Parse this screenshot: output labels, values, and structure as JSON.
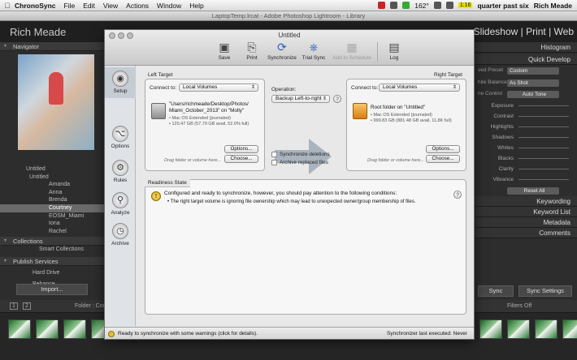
{
  "menubar": {
    "app_name": "ChronoSync",
    "items": [
      "File",
      "Edit",
      "View",
      "Actions",
      "Window",
      "Help"
    ],
    "temp": "162°",
    "battery": "1:16",
    "clock": "quarter past six",
    "user": "Rich Meade"
  },
  "lightroom": {
    "window_title": "LaptopTemp.lrcat - Adobe Photoshop Lightroom - Library",
    "user_name": "Rich Meade",
    "modules": "Slideshow | Print | Web",
    "navigator_label": "Navigator",
    "folders": [
      "Untitled",
      "Untitled",
      "Amanda",
      "Anna",
      "Brenda",
      "Courtney",
      "EOSM_Miami",
      "Iona",
      "Rachel"
    ],
    "collections_label": "Collections",
    "smart_collections_label": "Smart Collections",
    "publish_services_label": "Publish Services",
    "hard_drive_label": "Hard Drive",
    "behance_label": "Behance",
    "import_button": "Import...",
    "right_panels": {
      "histogram": "Histogram",
      "quick_develop": "Quick Develop",
      "saved_preset_label": "ved Preset",
      "saved_preset_value": "Custom",
      "white_balance_label": "hite Balance",
      "white_balance_value": "As Shot",
      "tone_control_label": "ne Control",
      "auto_tone": "Auto Tone",
      "exposure": "Exposure",
      "contrast": "Contrast",
      "highlights": "Highlights",
      "shadows": "Shadows",
      "whites": "Whites",
      "blacks": "Blacks",
      "clarity": "Clarity",
      "vibrance": "Vibrance",
      "reset_all": "Reset All",
      "keywording": "Keywording",
      "keyword_list": "Keyword List",
      "metadata": "Metadata",
      "comments": "Comments",
      "sync_button": "Sync",
      "sync_settings_button": "Sync Settings"
    },
    "filmstrip": {
      "page_1": "1",
      "page_2": "2",
      "folder_label": "Folder : Cou",
      "filter_label": "Filters Off"
    }
  },
  "chronosync": {
    "title": "Untitled",
    "toolbar": [
      "Save",
      "Print",
      "Synchronize",
      "Trial Sync",
      "Add to Schedule",
      "Log"
    ],
    "sidebar": [
      "Setup",
      "Options",
      "Rules",
      "Analyze",
      "Archive"
    ],
    "left_target": {
      "label": "Left Target",
      "connect_to_label": "Connect to:",
      "connect_to_value": "Local Volumes",
      "path_line1": "\"Users/richmeade/Desktop/Photos/",
      "path_line2": "Miami_October_2013\" on \"Molly\"",
      "format": "• Mac OS Extended (journaled)",
      "capacity": "• 120.47 GB (57.79 GB avail, 52.0% full)",
      "options_button": "Options...",
      "choose_button": "Choose...",
      "hint": "Drag folder or volume here..."
    },
    "right_target": {
      "label": "Right Target",
      "connect_to_label": "Connect to:",
      "connect_to_value": "Local Volumes",
      "path_line1": "Root folder on \"Untitled\"",
      "format": "• Mac OS Extended (journaled)",
      "capacity": "• 999.83 GB (881.48 GB avail, 11.8K full)",
      "options_button": "Options...",
      "choose_button": "Choose...",
      "hint": "Drag folder or volume here..."
    },
    "operation": {
      "label": "Operation:",
      "value": "Backup Left-to-right",
      "synchronize_deletions": "Synchronize deletions",
      "archive_replaced": "Archive replaced files"
    },
    "readiness": {
      "label": "Readiness State",
      "main": "Configured and ready to synchronize, however, you should pay attention to the following conditions:",
      "bullet": "• The right target volume is ignoring file ownership which may lead to unexpected owner/group membership of files."
    },
    "status": {
      "message": "Ready to synchronize with some warnings (click for details).",
      "last_executed": "Synchronizer last executed:  Never"
    }
  },
  "colors": {
    "accent_arrow": "#aab4bf",
    "lightroom_bg": "#2b2b2b",
    "warning": "#e2c12d"
  }
}
